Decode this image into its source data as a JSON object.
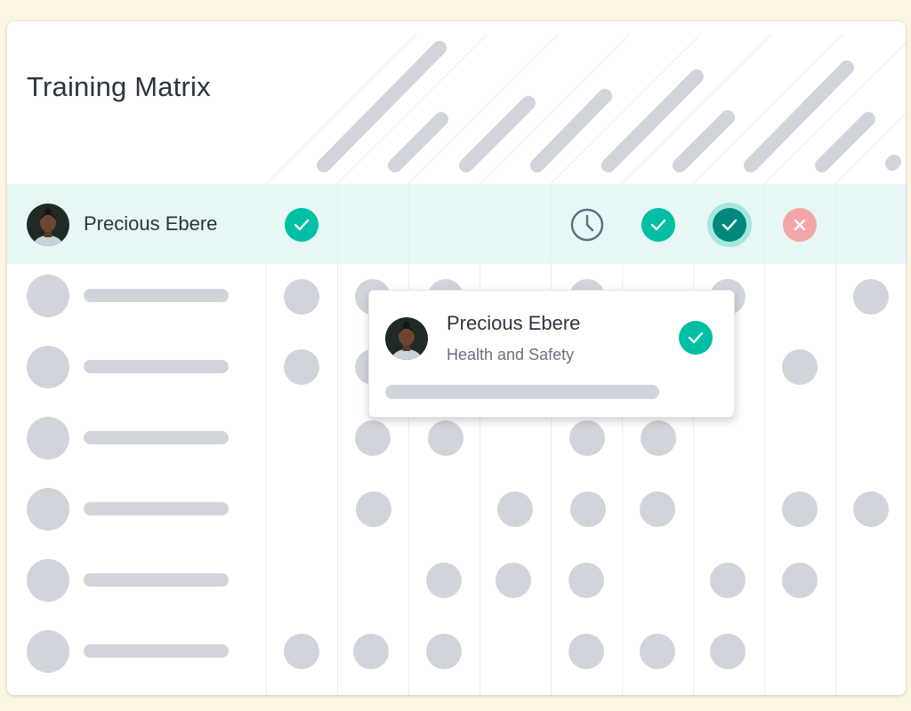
{
  "page": {
    "title": "Training Matrix"
  },
  "highlighted_row": {
    "name": "Precious Ebere",
    "statuses": [
      "complete",
      "none",
      "none",
      "none",
      "pending",
      "complete",
      "complete-selected",
      "failed",
      "none"
    ]
  },
  "popup": {
    "name": "Precious Ebere",
    "course": "Health and Safety",
    "status": "complete"
  },
  "colors": {
    "complete": "#00bfa5",
    "complete_selected": "#00897b",
    "failed": "#f3a6a6",
    "pending": "#5c6b80",
    "highlight_row": "#e6f7f5",
    "placeholder": "#d1d5db"
  }
}
